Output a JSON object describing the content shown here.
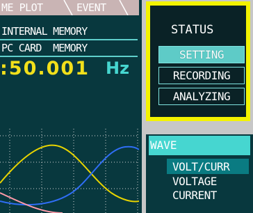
{
  "tabs": [
    "ME PLOT",
    "EVENT"
  ],
  "memory_rows": [
    "INTERNAL MEMORY",
    "PC CARD  MEMORY"
  ],
  "frequency": {
    "value": ":50.001",
    "unit": "Hz"
  },
  "menu": {
    "title": "STATUS",
    "items": [
      {
        "label": "SETTING",
        "selected": true
      },
      {
        "label": "RECORDING",
        "selected": false
      },
      {
        "label": "ANALYZING",
        "selected": false
      }
    ],
    "highlight_color": "#f3f300"
  },
  "wave": {
    "title": "WAVE",
    "options": [
      {
        "label": "VOLT/CURR",
        "selected": true
      },
      {
        "label": "VOLTAGE",
        "selected": false
      },
      {
        "label": "CURRENT",
        "selected": false
      }
    ]
  },
  "colors": {
    "panel_bg": "#08383e",
    "accent_cyan": "#46d6d0",
    "frequency_yellow": "#f2e01b",
    "trace_yellow": "#e8d400",
    "trace_blue": "#2f6ef5",
    "trace_pink": "#ff9aa8"
  }
}
